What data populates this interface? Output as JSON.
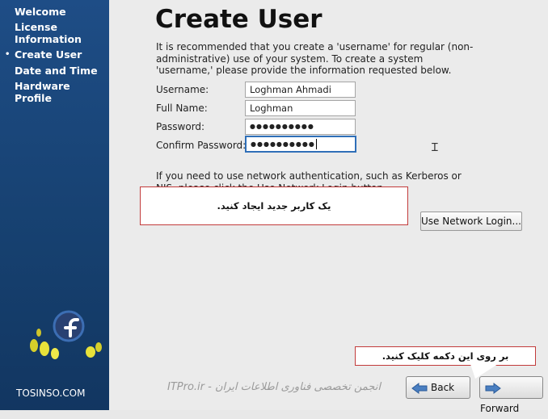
{
  "sidebar": {
    "items": [
      {
        "label": "Welcome",
        "active": false
      },
      {
        "label": "License Information",
        "active": false
      },
      {
        "label": "Create User",
        "active": true
      },
      {
        "label": "Date and Time",
        "active": false
      },
      {
        "label": "Hardware Profile",
        "active": false
      }
    ],
    "active_marker": "•",
    "brand": "TOSINSO.COM",
    "logo_icon": "fedora-logo-icon"
  },
  "main": {
    "title": "Create User",
    "intro": "It is recommended that you create a 'username' for regular (non-administrative) use of your system. To create a system 'username,' please provide the information requested below.",
    "fields": {
      "username": {
        "label": "Username:",
        "value": "Loghman Ahmadi"
      },
      "fullname": {
        "label": "Full Name:",
        "value": "Loghman"
      },
      "password": {
        "label": "Password:",
        "value": "●●●●●●●●●●"
      },
      "confirm": {
        "label": "Confirm Password:",
        "value": "●●●●●●●●●●"
      }
    },
    "network_text": "If you need to use network authentication, such as Kerberos or NIS, please click the Use Network Login button.",
    "network_button": "Use Network Login..."
  },
  "annotations": {
    "callout1": "یک کاربر جدید ایجاد کنید.",
    "callout2": "بر روی این دکمه کلیک کنید.",
    "watermark": "ITPro.ir - انجمن تخصصی فناوری اطلاعات ایران"
  },
  "nav": {
    "back_label": "Back",
    "forward_label": "Forward"
  },
  "colors": {
    "sidebar_bg": "#1a4780",
    "callout_border": "#c23b3b",
    "focus_border": "#2f6fb8"
  }
}
